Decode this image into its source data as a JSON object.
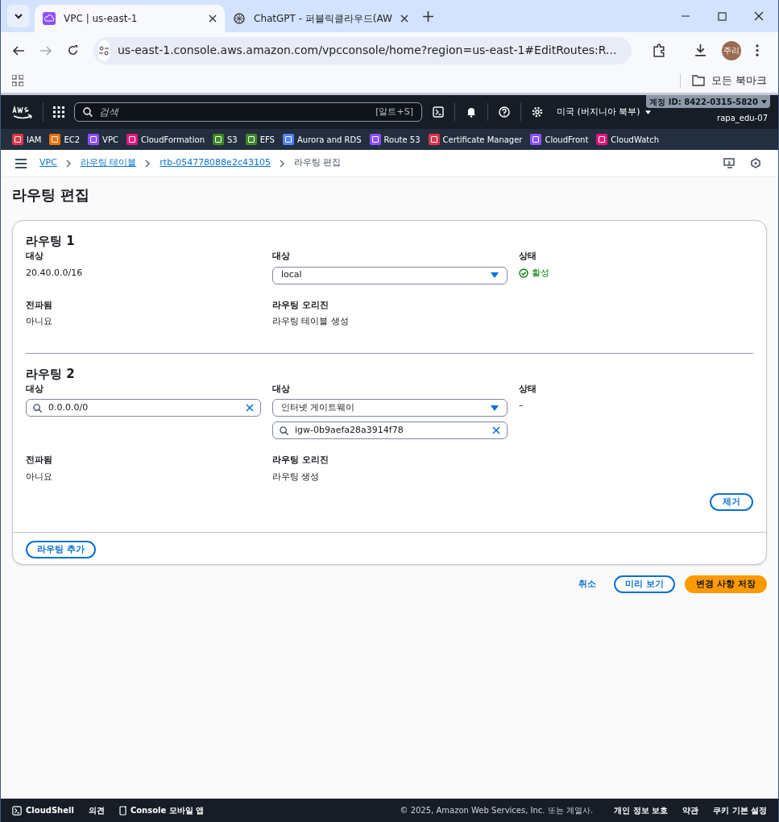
{
  "browser": {
    "tabs": [
      {
        "title": "VPC | us-east-1",
        "selected": true,
        "kind": "vpc"
      },
      {
        "title": "ChatGPT - 퍼블릭클라우드(AW",
        "selected": false,
        "kind": "chat"
      }
    ],
    "address": "us-east-1.console.aws.amazon.com/vpcconsole/home?region=us-east-1#EditRoutes:R...",
    "profile": "주리",
    "bookmarks": "모든 북마크"
  },
  "aws_header": {
    "search_placeholder": "검색",
    "shortcut": "[알트+S]",
    "region": "미국 (버지니아 북부)",
    "account": "계정 ID: 8422-0315-5820",
    "user": "rapa_edu-07"
  },
  "favorites": [
    {
      "label": "IAM",
      "color": "#dd344c"
    },
    {
      "label": "EC2",
      "color": "#ed7100"
    },
    {
      "label": "VPC",
      "color": "#8c4fff"
    },
    {
      "label": "CloudFormation",
      "color": "#e7157b"
    },
    {
      "label": "S3",
      "color": "#3f8624"
    },
    {
      "label": "EFS",
      "color": "#3f8624"
    },
    {
      "label": "Aurora and RDS",
      "color": "#527fff"
    },
    {
      "label": "Route 53",
      "color": "#8c4fff"
    },
    {
      "label": "Certificate Manager",
      "color": "#dd344c"
    },
    {
      "label": "CloudFront",
      "color": "#8c4fff"
    },
    {
      "label": "CloudWatch",
      "color": "#e7157b"
    }
  ],
  "breadcrumbs": [
    {
      "label": "VPC",
      "link": true
    },
    {
      "label": "라우팅 테이블",
      "link": true
    },
    {
      "label": "rtb-054778088e2c43105",
      "link": true
    },
    {
      "label": "라우팅 편집",
      "link": false
    }
  ],
  "page_title": "라우팅 편집",
  "routes": [
    {
      "title": "라우팅 1",
      "destination_label": "대상",
      "destination": {
        "kind": "text",
        "value": "20.40.0.0/16"
      },
      "target_label": "대상",
      "target": "local",
      "status_label": "상태",
      "status": {
        "kind": "active",
        "text": "활성"
      },
      "propagated_label": "전파됨",
      "propagated": "아니요",
      "origin_label": "라우팅 오리진",
      "origin": "라우팅 테이블 생성"
    },
    {
      "title": "라우팅 2",
      "destination_label": "대상",
      "destination": {
        "kind": "search",
        "value": "0.0.0.0/0"
      },
      "target_label": "대상",
      "target": "인터넷 게이트웨이",
      "target_search": "igw-0b9aefa28a3914f78",
      "status_label": "상태",
      "status": {
        "kind": "none",
        "text": "–"
      },
      "propagated_label": "전파됨",
      "propagated": "아니요",
      "origin_label": "라우팅 오리진",
      "origin": "라우팅 생성",
      "remove_button": "제거"
    }
  ],
  "add_button": "라우팅 추가",
  "actions": {
    "cancel": "취소",
    "preview": "미리 보기",
    "save": "변경 사항 저장"
  },
  "footer": {
    "cloudshell": "CloudShell",
    "feedback": "의견",
    "mobile": "Console 모바일 앱",
    "copyright": "© 2025, Amazon Web Services, Inc. 또는 계열사.",
    "links": [
      "개인 정보 보호",
      "약관",
      "쿠키 기본 설정"
    ]
  }
}
